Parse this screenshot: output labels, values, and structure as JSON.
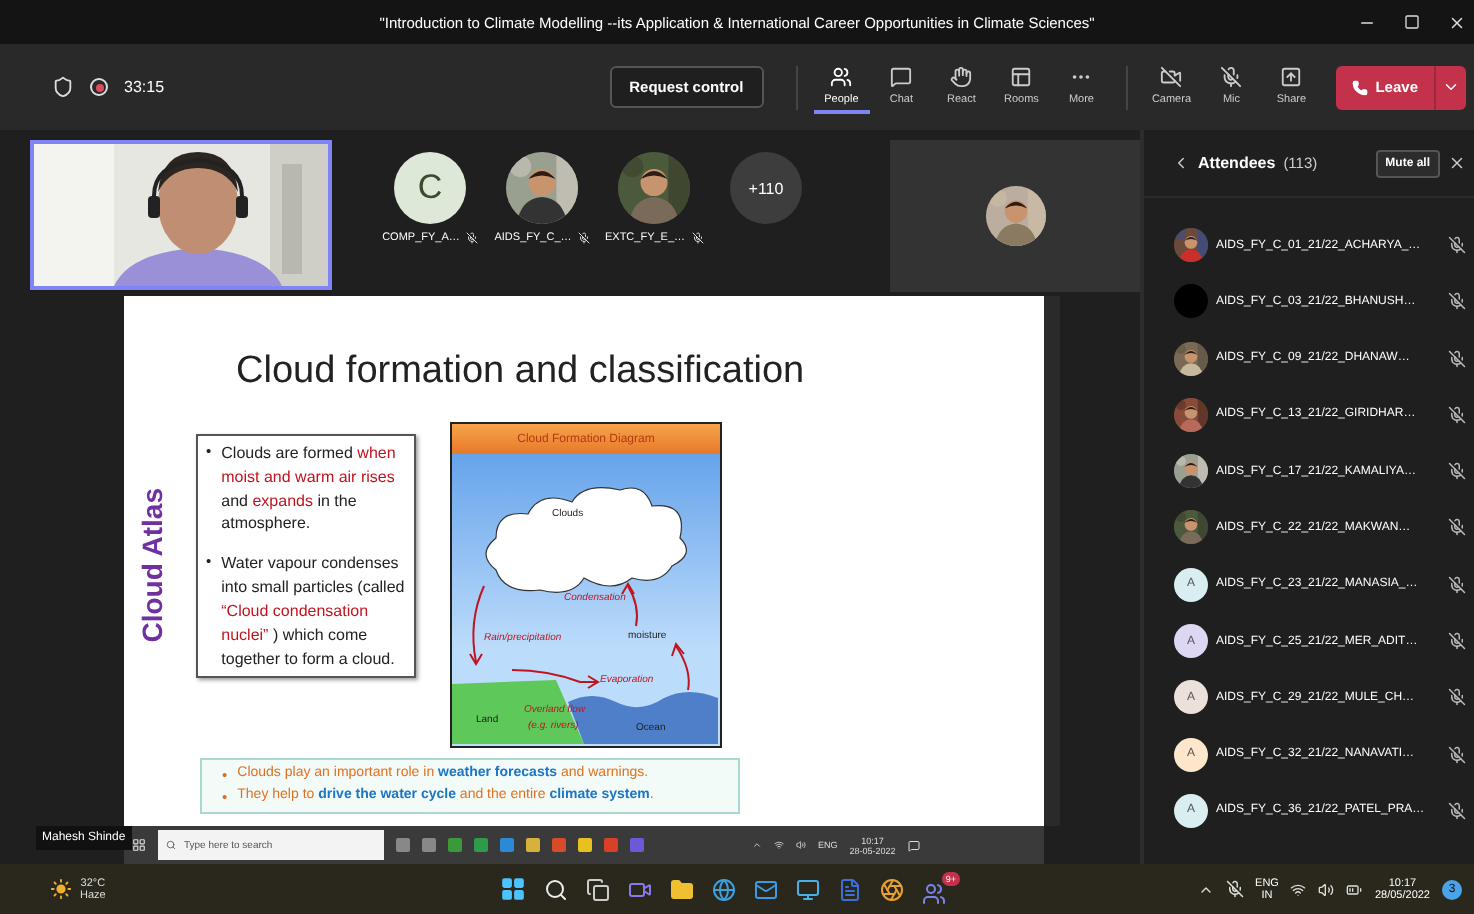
{
  "window": {
    "title": "\"Introduction to Climate Modelling --its Application & International Career Opportunities in Climate Sciences\""
  },
  "meeting": {
    "recording": true,
    "timer": "33:15"
  },
  "toolbar": {
    "request_control": "Request control",
    "items": [
      {
        "kind": "people",
        "label": "People",
        "selected": true
      },
      {
        "kind": "chat",
        "label": "Chat",
        "selected": false
      },
      {
        "kind": "react",
        "label": "React",
        "selected": false
      },
      {
        "kind": "rooms",
        "label": "Rooms",
        "selected": false
      },
      {
        "kind": "more",
        "label": "More",
        "selected": false
      }
    ],
    "devices": [
      {
        "kind": "camera",
        "label": "Camera"
      },
      {
        "kind": "mic",
        "label": "Mic"
      },
      {
        "kind": "share",
        "label": "Share"
      }
    ],
    "leave": "Leave"
  },
  "participants": [
    {
      "kind": "letter",
      "initial": "C",
      "name": "COMP_FY_A…",
      "muted": true
    },
    {
      "kind": "picture",
      "name": "AIDS_FY_C_…",
      "muted": true
    },
    {
      "kind": "picture",
      "name": "EXTC_FY_E_…",
      "muted": true
    },
    {
      "kind": "overflow",
      "count": "+110"
    }
  ],
  "share": {
    "presenter": "Mahesh Shinde",
    "slide": {
      "title": "Cloud formation and classification",
      "side_title": "Cloud Atlas",
      "bullets": [
        {
          "marker": "•",
          "text": "Clouds are formed **when moist and warm air rises** and **expands** in the atmosphere."
        },
        {
          "marker": "•",
          "text": "Water vapour condenses into small particles (called **“Cloud condensation nuclei”** ) which come together to form a cloud."
        }
      ],
      "diagram": {
        "title": "Cloud Formation Diagram",
        "labels": [
          "Clouds",
          "Condensation",
          "moisture",
          "Rain/precipitation",
          "Evaporation",
          "Land",
          "Overland flow",
          "(e.g. rivers)",
          "Ocean"
        ]
      },
      "notes": [
        {
          "marker": "•",
          "text": "Clouds play an important role in **weather forecasts** and warnings."
        },
        {
          "marker": "•",
          "text": "They help to **drive the water cycle** and the entire **climate system**."
        }
      ]
    },
    "taskbar": {
      "search_placeholder": "Type here to search",
      "language": "ENG",
      "time": "10:17",
      "date": "28-05-2022"
    }
  },
  "attendees": {
    "title": "Attendees",
    "count": "(113)",
    "mute_all": "Mute all",
    "rows": [
      {
        "kind": "picture",
        "name": "AIDS_FY_C_01_21/22_ACHARYA_…",
        "muted": true
      },
      {
        "kind": "plain",
        "color": "#000000",
        "name": "AIDS_FY_C_03_21/22_BHANUSH…",
        "muted": true
      },
      {
        "kind": "picture",
        "name": "AIDS_FY_C_09_21/22_DHANAW…",
        "muted": true
      },
      {
        "kind": "picture",
        "name": "AIDS_FY_C_13_21/22_GIRIDHAR…",
        "muted": true
      },
      {
        "kind": "picture",
        "name": "AIDS_FY_C_17_21/22_KAMALIYA…",
        "muted": true
      },
      {
        "kind": "picture",
        "name": "AIDS_FY_C_22_21/22_MAKWAN…",
        "muted": true
      },
      {
        "kind": "letter",
        "initial": "A",
        "color": "#d8eef1",
        "name": "AIDS_FY_C_23_21/22_MANASIA_…",
        "muted": true
      },
      {
        "kind": "letter",
        "initial": "A",
        "color": "#ddd7f3",
        "name": "AIDS_FY_C_25_21/22_MER_ADIT…",
        "muted": true
      },
      {
        "kind": "letter",
        "initial": "A",
        "color": "#ebe0da",
        "name": "AIDS_FY_C_29_21/22_MULE_CH…",
        "muted": true
      },
      {
        "kind": "letter",
        "initial": "A",
        "color": "#fde6c9",
        "name": "AIDS_FY_C_32_21/22_NANAVATI…",
        "muted": true
      },
      {
        "kind": "letter",
        "initial": "A",
        "color": "#d8eef1",
        "name": "AIDS_FY_C_36_21/22_PATEL_PRA…",
        "muted": true
      }
    ]
  },
  "taskbar": {
    "weather": {
      "temp": "32°C",
      "condition": "Haze"
    },
    "teams_badge": "9+",
    "language": "ENG",
    "region": "IN",
    "time": "10:17",
    "date": "28/05/2022",
    "notifications": "3"
  }
}
